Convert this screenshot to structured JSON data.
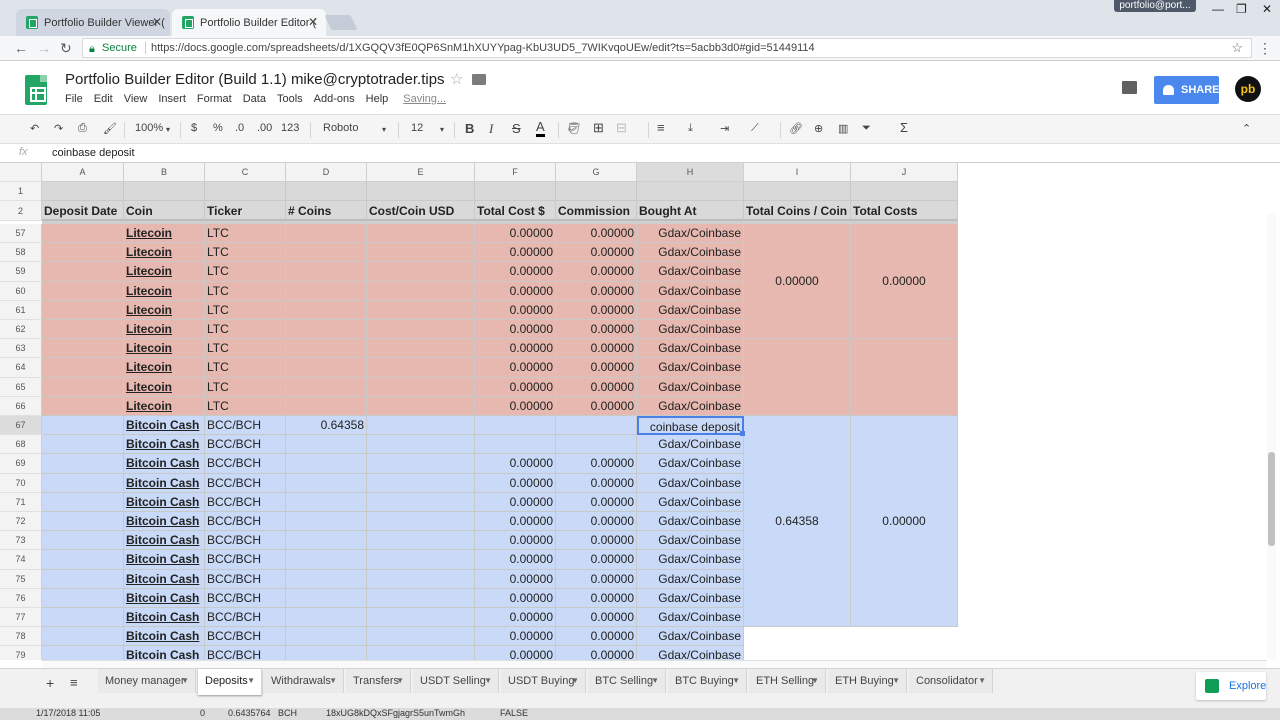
{
  "browser": {
    "tabs": [
      {
        "title": "Portfolio Builder Viewer (",
        "active": false
      },
      {
        "title": "Portfolio Builder Editor (",
        "active": true
      }
    ],
    "profile": "portfolio@port...",
    "secure_label": "Secure",
    "url": "https://docs.google.com/spreadsheets/d/1XGQQV3fE0QP6SnM1hXUYYpag-KbU3UD5_7WIKvqoUEw/edit?ts=5acbb3d0#gid=51449114"
  },
  "app": {
    "title": "Portfolio Builder Editor (Build 1.1)  mike@cryptotrader.tips",
    "menus": [
      "File",
      "Edit",
      "View",
      "Insert",
      "Format",
      "Data",
      "Tools",
      "Add-ons",
      "Help"
    ],
    "saving": "Saving...",
    "share_label": "SHARE",
    "avatar_initials": "pb",
    "accent_green": "#23a566",
    "share_blue": "#4a88ee"
  },
  "toolbar": {
    "zoom": "100%",
    "currency": "$",
    "percent": "%",
    "dec_less": ".0",
    "dec_more": ".00",
    "more_formats": "123",
    "font": "Roboto",
    "font_size": "12",
    "bold": "B",
    "italic": "I",
    "strike": "S",
    "textcolor": "A",
    "sigma": "Σ"
  },
  "formula_bar": {
    "fx": "fx",
    "value": "coinbase deposit"
  },
  "columns": [
    "A",
    "B",
    "C",
    "D",
    "E",
    "F",
    "G",
    "H",
    "I",
    "J"
  ],
  "headers": [
    "Deposit Date",
    "Coin",
    "Ticker",
    "# Coins",
    "Cost/Coin USD",
    "Total Cost $",
    "Commission",
    "Bought At",
    "Total Coins / Coin",
    "Total Costs"
  ],
  "header_rows": [
    "1",
    "2"
  ],
  "rows": [
    {
      "n": "57",
      "coin": "Litecoin",
      "ticker": "LTC",
      "coins": "",
      "total": "0.00000",
      "comm": "0.00000",
      "at": "Gdax/Coinbase"
    },
    {
      "n": "58",
      "coin": "Litecoin",
      "ticker": "LTC",
      "coins": "",
      "total": "0.00000",
      "comm": "0.00000",
      "at": "Gdax/Coinbase"
    },
    {
      "n": "59",
      "coin": "Litecoin",
      "ticker": "LTC",
      "coins": "",
      "total": "0.00000",
      "comm": "0.00000",
      "at": "Gdax/Coinbase"
    },
    {
      "n": "60",
      "coin": "Litecoin",
      "ticker": "LTC",
      "coins": "",
      "total": "0.00000",
      "comm": "0.00000",
      "at": "Gdax/Coinbase"
    },
    {
      "n": "61",
      "coin": "Litecoin",
      "ticker": "LTC",
      "coins": "",
      "total": "0.00000",
      "comm": "0.00000",
      "at": "Gdax/Coinbase"
    },
    {
      "n": "62",
      "coin": "Litecoin",
      "ticker": "LTC",
      "coins": "",
      "total": "0.00000",
      "comm": "0.00000",
      "at": "Gdax/Coinbase"
    },
    {
      "n": "63",
      "coin": "Litecoin",
      "ticker": "LTC",
      "coins": "",
      "total": "0.00000",
      "comm": "0.00000",
      "at": "Gdax/Coinbase"
    },
    {
      "n": "64",
      "coin": "Litecoin",
      "ticker": "LTC",
      "coins": "",
      "total": "0.00000",
      "comm": "0.00000",
      "at": "Gdax/Coinbase"
    },
    {
      "n": "65",
      "coin": "Litecoin",
      "ticker": "LTC",
      "coins": "",
      "total": "0.00000",
      "comm": "0.00000",
      "at": "Gdax/Coinbase"
    },
    {
      "n": "66",
      "coin": "Litecoin",
      "ticker": "LTC",
      "coins": "",
      "total": "0.00000",
      "comm": "0.00000",
      "at": "Gdax/Coinbase"
    },
    {
      "n": "67",
      "coin": "Bitcoin Cash",
      "ticker": "BCC/BCH",
      "coins": "0.64358",
      "total": "",
      "comm": "",
      "at": "coinbase deposit"
    },
    {
      "n": "68",
      "coin": "Bitcoin Cash",
      "ticker": "BCC/BCH",
      "coins": "",
      "total": "",
      "comm": "",
      "at": "Gdax/Coinbase"
    },
    {
      "n": "69",
      "coin": "Bitcoin Cash",
      "ticker": "BCC/BCH",
      "coins": "",
      "total": "0.00000",
      "comm": "0.00000",
      "at": "Gdax/Coinbase"
    },
    {
      "n": "70",
      "coin": "Bitcoin Cash",
      "ticker": "BCC/BCH",
      "coins": "",
      "total": "0.00000",
      "comm": "0.00000",
      "at": "Gdax/Coinbase"
    },
    {
      "n": "71",
      "coin": "Bitcoin Cash",
      "ticker": "BCC/BCH",
      "coins": "",
      "total": "0.00000",
      "comm": "0.00000",
      "at": "Gdax/Coinbase"
    },
    {
      "n": "72",
      "coin": "Bitcoin Cash",
      "ticker": "BCC/BCH",
      "coins": "",
      "total": "0.00000",
      "comm": "0.00000",
      "at": "Gdax/Coinbase"
    },
    {
      "n": "73",
      "coin": "Bitcoin Cash",
      "ticker": "BCC/BCH",
      "coins": "",
      "total": "0.00000",
      "comm": "0.00000",
      "at": "Gdax/Coinbase"
    },
    {
      "n": "74",
      "coin": "Bitcoin Cash",
      "ticker": "BCC/BCH",
      "coins": "",
      "total": "0.00000",
      "comm": "0.00000",
      "at": "Gdax/Coinbase"
    },
    {
      "n": "75",
      "coin": "Bitcoin Cash",
      "ticker": "BCC/BCH",
      "coins": "",
      "total": "0.00000",
      "comm": "0.00000",
      "at": "Gdax/Coinbase"
    },
    {
      "n": "76",
      "coin": "Bitcoin Cash",
      "ticker": "BCC/BCH",
      "coins": "",
      "total": "0.00000",
      "comm": "0.00000",
      "at": "Gdax/Coinbase"
    },
    {
      "n": "77",
      "coin": "Bitcoin Cash",
      "ticker": "BCC/BCH",
      "coins": "",
      "total": "0.00000",
      "comm": "0.00000",
      "at": "Gdax/Coinbase"
    },
    {
      "n": "78",
      "coin": "Bitcoin Cash",
      "ticker": "BCC/BCH",
      "coins": "",
      "total": "0.00000",
      "comm": "0.00000",
      "at": "Gdax/Coinbase"
    },
    {
      "n": "79",
      "coin": "Bitcoin Cash",
      "ticker": "BCC/BCH",
      "coins": "",
      "total": "0.00000",
      "comm": "0.00000",
      "at": "Gdax/Coinbase"
    }
  ],
  "merged": {
    "ltc_total_coins": "0.00000",
    "ltc_total_costs": "0.00000",
    "bch_total_coins": "0.64358",
    "bch_total_costs": "0.00000"
  },
  "row_colors": {
    "litecoin": "#e6b8af",
    "bitcoin_cash": "#c9daf8"
  },
  "sheet_tabs": [
    "Money manager",
    "Deposits",
    "Withdrawals",
    "Transfers",
    "USDT Selling",
    "USDT Buying",
    "BTC Selling",
    "BTC Buying",
    "ETH Selling",
    "ETH Buying",
    "Consolidator"
  ],
  "active_sheet": "Deposits",
  "explore_label": "Explore",
  "bottom_strip": [
    "1/17/2018 11:05",
    "0",
    "0.6435764",
    "BCH",
    "18xUG8kDQxSFgjagrS5unTwmGh",
    "FALSE"
  ]
}
